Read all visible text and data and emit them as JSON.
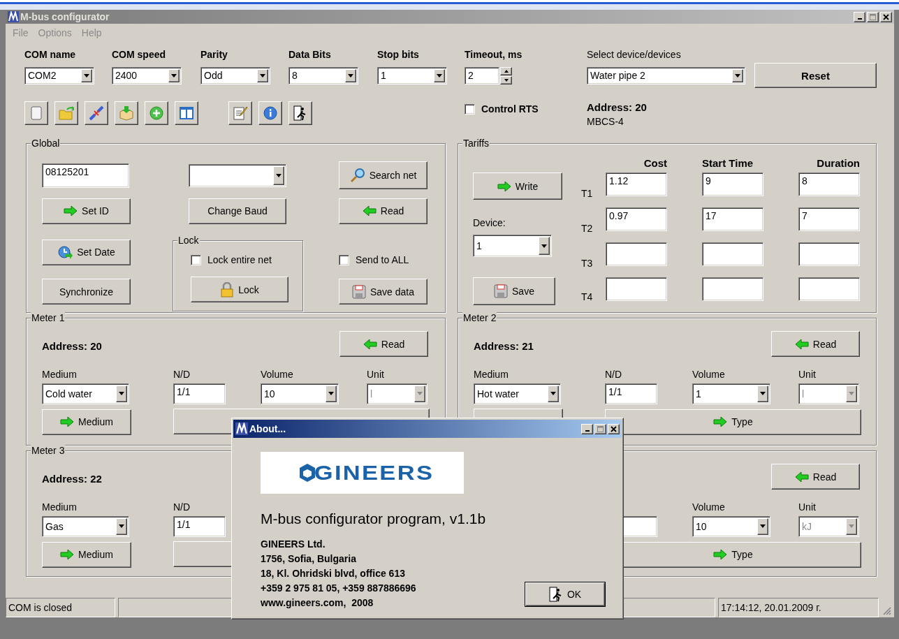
{
  "window": {
    "title": "M-bus configurator"
  },
  "menu": [
    {
      "label": "File",
      "disabled": true
    },
    {
      "label": "Options",
      "disabled": true
    },
    {
      "label": "Help",
      "disabled": true
    }
  ],
  "port_settings": [
    {
      "label": "COM name",
      "value": "COM2"
    },
    {
      "label": "COM speed",
      "value": "2400"
    },
    {
      "label": "Parity",
      "value": "Odd"
    },
    {
      "label": "Data Bits",
      "value": "8"
    },
    {
      "label": "Stop bits",
      "value": "1"
    }
  ],
  "timeout": {
    "label": "Timeout, ms",
    "value": "2"
  },
  "device_select": {
    "label": "Select device/devices",
    "value": "Water pipe 2"
  },
  "reset_button": "Reset",
  "control_rts": {
    "label": "Control RTS",
    "checked": false
  },
  "device_info": {
    "address": "Address: 20",
    "model": "MBCS-4"
  },
  "global": {
    "title": "Global",
    "id_value": "08125201",
    "search_net": "Search net",
    "set_id": "Set ID",
    "change_baud": "Change Baud",
    "read": "Read",
    "set_date": "Set Date",
    "synchronize": "Synchronize",
    "save_data": "Save data",
    "send_to_all": {
      "label": "Send to ALL",
      "checked": false
    },
    "lock": {
      "title": "Lock",
      "lock_entire_net": {
        "label": "Lock entire net",
        "checked": false
      },
      "button": "Lock"
    }
  },
  "tariffs": {
    "title": "Tariffs",
    "columns": [
      "Cost",
      "Start Time",
      "Duration"
    ],
    "write": "Write",
    "device_label": "Device:",
    "device": "1",
    "save": "Save",
    "rows": [
      {
        "label": "T1",
        "cost": "1.12",
        "start_time": "9",
        "duration": "8"
      },
      {
        "label": "T2",
        "cost": "0.97",
        "start_time": "17",
        "duration": "7"
      },
      {
        "label": "T3"
      },
      {
        "label": "T4"
      }
    ]
  },
  "meters": [
    {
      "title": "Meter 1",
      "address": "Address: 20",
      "read": "Read",
      "medium_label": "Medium",
      "nd_label": "N/D",
      "volume_label": "Volume",
      "unit_label": "Unit",
      "medium": "Cold water",
      "nd": "1/1",
      "volume": "10",
      "unit": "l",
      "unit_disabled": true,
      "medium_button": "Medium",
      "type_button": true
    },
    {
      "title": "Meter 2",
      "address": "Address: 21",
      "read": "Read",
      "medium_label": "Medium",
      "nd_label": "N/D",
      "volume_label": "Volume",
      "unit_label": "Unit",
      "medium": "Hot water",
      "nd": "1/1",
      "volume": "1",
      "unit": "l",
      "unit_disabled": true,
      "medium_button": true,
      "type_button": "Type"
    },
    {
      "title": "Meter 3",
      "address": "Address: 22",
      "medium_label": "Medium",
      "nd_label": "N/D",
      "medium": "Gas",
      "nd": "1/1",
      "medium_button": "Medium",
      "type_button": true
    },
    {
      "read": "Read",
      "volume_label": "Volume",
      "unit_label": "Unit",
      "nd": true,
      "volume": "10",
      "unit": "kJ",
      "unit_disabled": true,
      "type_button": "Type"
    }
  ],
  "status_bar": {
    "connection": "COM is closed",
    "datetime": "17:14:12, 20.01.2009 г."
  },
  "about_dialog": {
    "title": "About...",
    "logo": "GINEERS",
    "program": "M-bus configurator program, v1.1b",
    "details": [
      "GINEERS Ltd.",
      "1756, Sofia, Bulgaria",
      "18, Kl. Ohridski blvd, office 613",
      "+359 2 975 81 05, +359 887886696",
      "www.gineers.com,  2008"
    ],
    "ok_button": "OK"
  }
}
